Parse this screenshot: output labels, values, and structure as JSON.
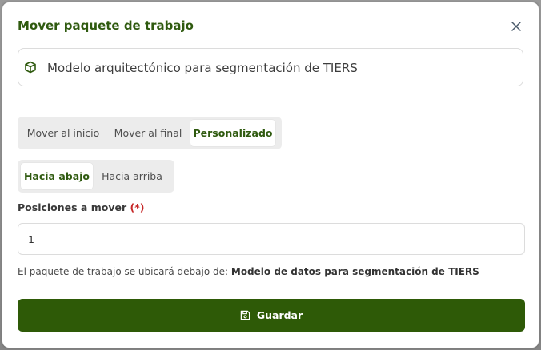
{
  "dialog": {
    "title": "Mover paquete de trabajo",
    "close_icon": "close-icon"
  },
  "package": {
    "icon": "cube-icon",
    "name": "Modelo arquitectónico para segmentación de TIERS"
  },
  "position_tabs": {
    "items": [
      {
        "label": "Mover al inicio",
        "active": false
      },
      {
        "label": "Mover al final",
        "active": false
      },
      {
        "label": "Personalizado",
        "active": true
      }
    ]
  },
  "direction_tabs": {
    "items": [
      {
        "label": "Hacia abajo",
        "active": true
      },
      {
        "label": "Hacia arriba",
        "active": false
      }
    ]
  },
  "positions": {
    "label": "Posiciones a mover",
    "required_mark": "(*)",
    "value": "1"
  },
  "hint": {
    "prefix": "El paquete de trabajo se ubicará debajo de:",
    "target": "Modelo de datos para segmentación de TIERS"
  },
  "save_button": {
    "label": "Guardar",
    "icon": "save-icon"
  },
  "colors": {
    "accent": "#2e5a07",
    "title": "#2f5a0f",
    "required": "#c62828"
  }
}
